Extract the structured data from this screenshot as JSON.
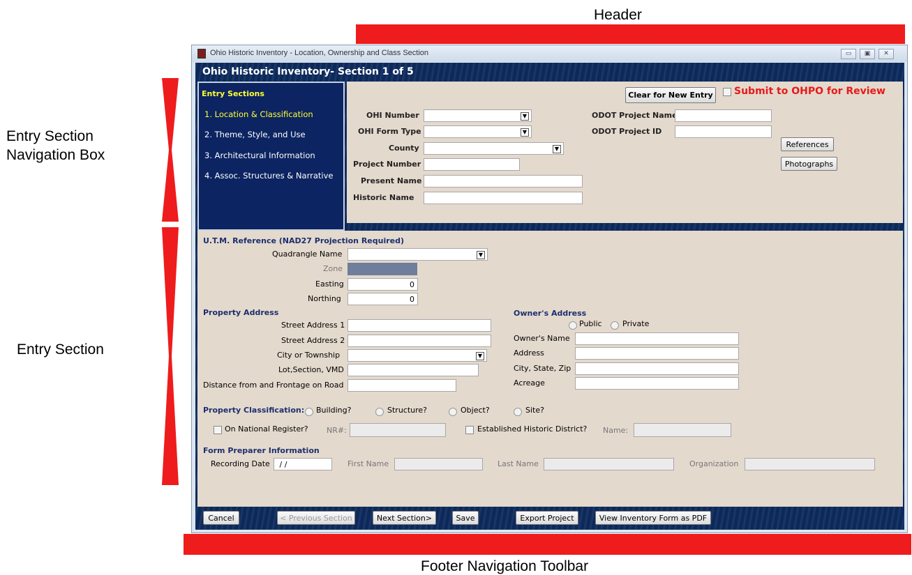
{
  "annotations": {
    "header": "Header",
    "nav_box_line1": "Entry Section",
    "nav_box_line2": "Navigation Box",
    "entry_section": "Entry Section",
    "footer": "Footer Navigation Toolbar"
  },
  "window": {
    "title": "Ohio Historic Inventory - Location, Ownership and Class Section",
    "header_title": "Ohio Historic Inventory- Section 1 of 5"
  },
  "nav": {
    "heading": "Entry Sections",
    "items": [
      {
        "label": "1. Location & Classification",
        "active": true
      },
      {
        "label": "2. Theme, Style, and Use",
        "active": false
      },
      {
        "label": "3. Architectural Information",
        "active": false
      },
      {
        "label": "4. Assoc. Structures & Narrative",
        "active": false
      }
    ]
  },
  "top_form": {
    "clear_button": "Clear for New Entry",
    "submit_label": "Submit to OHPO for Review",
    "ohi_number_label": "OHI Number",
    "ohi_form_type_label": "OHI Form Type",
    "county_label": "County",
    "project_number_label": "Project Number",
    "present_name_label": "Present Name",
    "historic_name_label": "Historic Name",
    "odot_project_name_label": "ODOT Project Name",
    "odot_project_id_label": "ODOT Project ID",
    "references_button": "References",
    "photographs_button": "Photographs"
  },
  "utm": {
    "heading": "U.T.M. Reference (NAD27 Projection Required)",
    "quadrangle_label": "Quadrangle Name",
    "zone_label": "Zone",
    "easting_label": "Easting",
    "easting_value": "0",
    "northing_label": "Northing",
    "northing_value": "0"
  },
  "property": {
    "heading": "Property Address",
    "street1_label": "Street Address 1",
    "street2_label": "Street Address 2",
    "city_label": "City or Township",
    "lot_label": "Lot,Section, VMD",
    "distance_label": "Distance from and Frontage on Road"
  },
  "owner": {
    "heading": "Owner's Address",
    "public_label": "Public",
    "private_label": "Private",
    "name_label": "Owner's Name",
    "address_label": "Address",
    "city_label": "City, State, Zip",
    "acreage_label": "Acreage"
  },
  "classification": {
    "label": "Property Classification:",
    "building": "Building?",
    "structure": "Structure?",
    "object": "Object?",
    "site": "Site?",
    "national_register": "On National Register?",
    "nr_label": "NR#:",
    "historic_district": "Established Historic District?",
    "name_label": "Name:"
  },
  "preparer": {
    "heading": "Form Preparer Information",
    "recording_date_label": "Recording Date",
    "recording_date_value": " / /",
    "first_name_label": "First Name",
    "last_name_label": "Last Name",
    "organization_label": "Organization"
  },
  "footer": {
    "cancel": "Cancel",
    "previous": "< Previous Section",
    "next": "Next Section>",
    "save": "Save",
    "export": "Export Project",
    "view_pdf": "View Inventory Form as PDF"
  },
  "colors": {
    "annotation_red": "#ee1c1c",
    "header_blue": "#0d2b5e",
    "panel": "#e4d9cd",
    "active_nav": "#ffff33",
    "submit_red": "#e8191a"
  }
}
